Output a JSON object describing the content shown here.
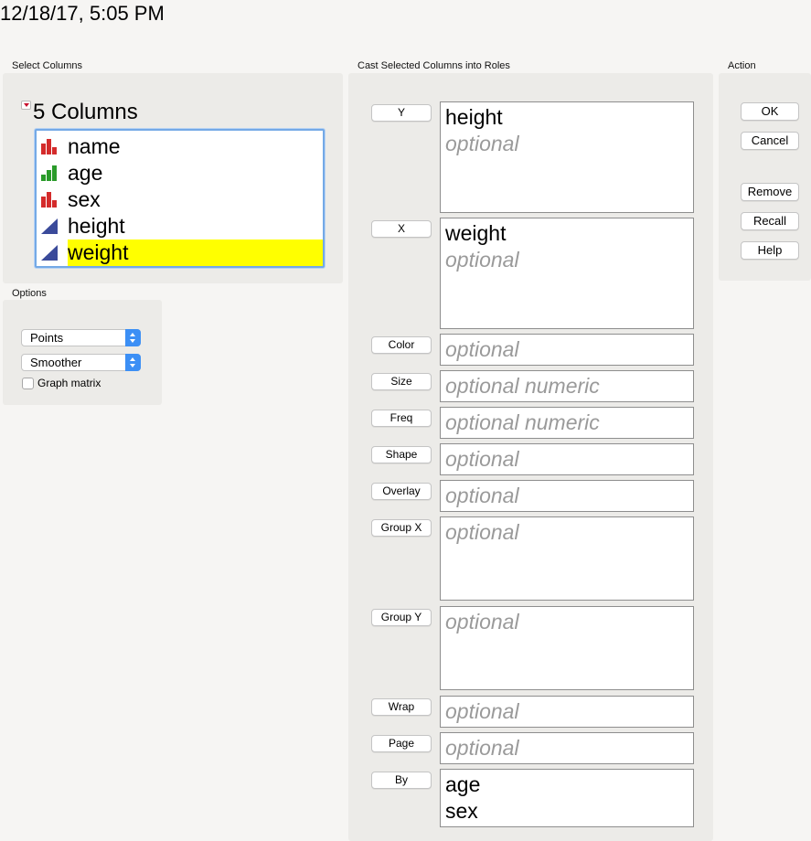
{
  "timestamp": "12/18/17, 5:05 PM",
  "select_columns": {
    "label": "Select Columns",
    "count_label": "5 Columns",
    "columns": [
      {
        "name": "name",
        "icon": "nominal-bar-icon",
        "color": "#d42b2b",
        "selected": false
      },
      {
        "name": "age",
        "icon": "ordinal-bar-icon",
        "color": "#2a9b2a",
        "selected": false
      },
      {
        "name": "sex",
        "icon": "nominal-bar-icon",
        "color": "#d42b2b",
        "selected": false
      },
      {
        "name": "height",
        "icon": "continuous-triangle-icon",
        "color": "#3a4a9a",
        "selected": false
      },
      {
        "name": "weight",
        "icon": "continuous-triangle-icon",
        "color": "#3a4a9a",
        "selected": true
      }
    ],
    "highlight_color": "#ffff00"
  },
  "options": {
    "label": "Options",
    "points_select": "Points",
    "smoother_select": "Smoother",
    "graph_matrix_label": "Graph matrix",
    "graph_matrix_checked": false
  },
  "roles": {
    "label": "Cast Selected Columns into Roles",
    "items": [
      {
        "button": "Y",
        "values": [
          "height"
        ],
        "placeholder": "optional"
      },
      {
        "button": "X",
        "values": [
          "weight"
        ],
        "placeholder": "optional"
      },
      {
        "button": "Color",
        "values": [],
        "placeholder": "optional"
      },
      {
        "button": "Size",
        "values": [],
        "placeholder": "optional numeric"
      },
      {
        "button": "Freq",
        "values": [],
        "placeholder": "optional numeric"
      },
      {
        "button": "Shape",
        "values": [],
        "placeholder": "optional"
      },
      {
        "button": "Overlay",
        "values": [],
        "placeholder": "optional"
      },
      {
        "button": "Group X",
        "values": [],
        "placeholder": "optional"
      },
      {
        "button": "Group Y",
        "values": [],
        "placeholder": "optional"
      },
      {
        "button": "Wrap",
        "values": [],
        "placeholder": "optional"
      },
      {
        "button": "Page",
        "values": [],
        "placeholder": "optional"
      },
      {
        "button": "By",
        "values": [
          "age",
          "sex"
        ],
        "placeholder": ""
      }
    ]
  },
  "action": {
    "label": "Action",
    "buttons": [
      "OK",
      "Cancel",
      "Remove",
      "Recall",
      "Help"
    ]
  }
}
